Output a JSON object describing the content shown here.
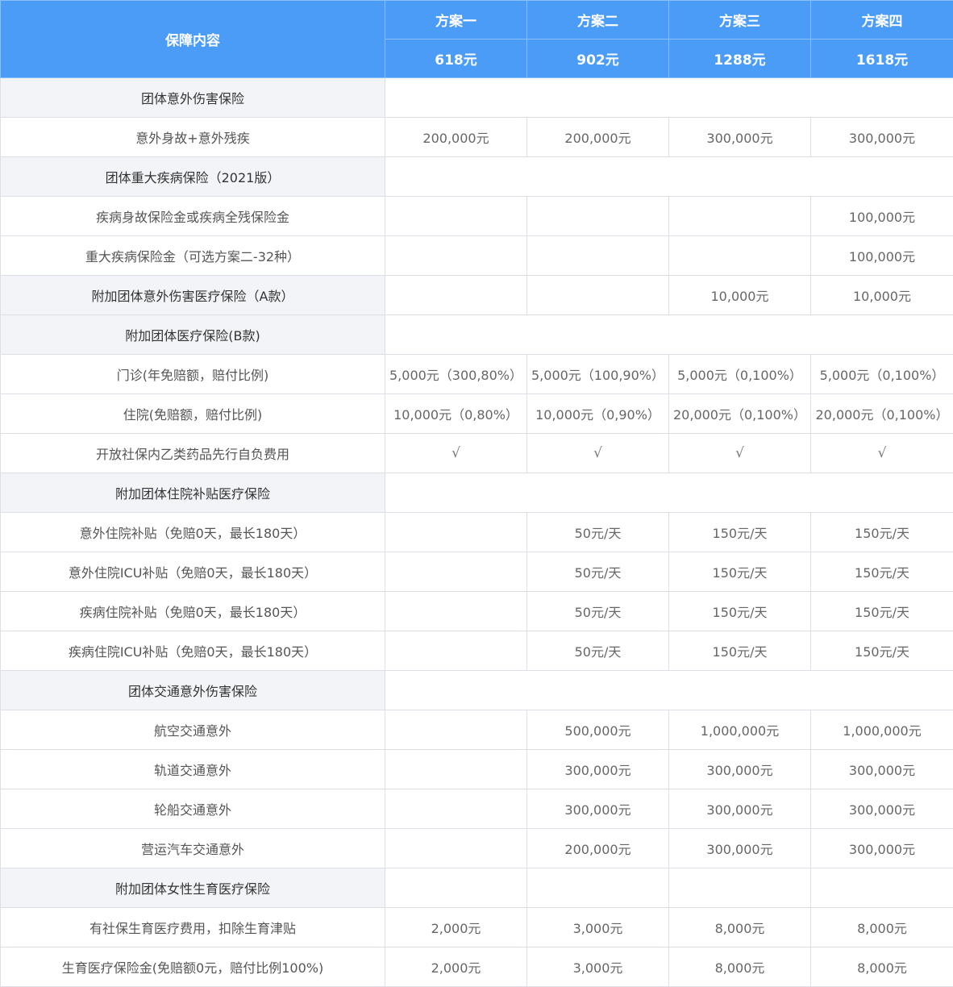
{
  "header": {
    "corner": "保障内容",
    "plans": [
      "方案一",
      "方案二",
      "方案三",
      "方案四"
    ],
    "prices": [
      "618元",
      "902元",
      "1288元",
      "1618元"
    ]
  },
  "rows": [
    {
      "type": "section",
      "label": "团体意外伤害保险",
      "merged": true
    },
    {
      "type": "item",
      "label": "意外身故+意外残疾",
      "values": [
        "200,000元",
        "200,000元",
        "300,000元",
        "300,000元"
      ]
    },
    {
      "type": "section",
      "label": "团体重大疾病保险（2021版）",
      "merged": true
    },
    {
      "type": "item",
      "label": "疾病身故保险金或疾病全残保险金",
      "values": [
        "",
        "",
        "",
        "100,000元"
      ]
    },
    {
      "type": "item",
      "label": "重大疾病保险金（可选方案二-32种）",
      "values": [
        "",
        "",
        "",
        "100,000元"
      ]
    },
    {
      "type": "section",
      "label": "附加团体意外伤害医疗保险（A款）",
      "merged": false,
      "values": [
        "",
        "",
        "10,000元",
        "10,000元"
      ]
    },
    {
      "type": "section",
      "label": "附加团体医疗保险(B款)",
      "merged": true
    },
    {
      "type": "item",
      "label": "门诊(年免赔额，赔付比例)",
      "values": [
        "5,000元（300,80%）",
        "5,000元（100,90%）",
        "5,000元（0,100%）",
        "5,000元（0,100%）"
      ]
    },
    {
      "type": "item",
      "label": "住院(免赔额，赔付比例)",
      "values": [
        "10,000元（0,80%）",
        "10,000元（0,90%）",
        "20,000元（0,100%）",
        "20,000元（0,100%）"
      ]
    },
    {
      "type": "item",
      "label": "开放社保内乙类药品先行自负费用",
      "values": [
        "√",
        "√",
        "√",
        "√"
      ]
    },
    {
      "type": "section",
      "label": "附加团体住院补贴医疗保险",
      "merged": true
    },
    {
      "type": "item",
      "label": "意外住院补贴（免赔0天，最长180天）",
      "values": [
        "",
        "50元/天",
        "150元/天",
        "150元/天"
      ]
    },
    {
      "type": "item",
      "label": "意外住院ICU补贴（免赔0天，最长180天）",
      "values": [
        "",
        "50元/天",
        "150元/天",
        "150元/天"
      ]
    },
    {
      "type": "item",
      "label": "疾病住院补贴（免赔0天，最长180天）",
      "values": [
        "",
        "50元/天",
        "150元/天",
        "150元/天"
      ]
    },
    {
      "type": "item",
      "label": "疾病住院ICU补贴（免赔0天，最长180天）",
      "values": [
        "",
        "50元/天",
        "150元/天",
        "150元/天"
      ]
    },
    {
      "type": "section",
      "label": "团体交通意外伤害保险",
      "merged": true
    },
    {
      "type": "item",
      "label": "航空交通意外",
      "values": [
        "",
        "500,000元",
        "1,000,000元",
        "1,000,000元"
      ]
    },
    {
      "type": "item",
      "label": "轨道交通意外",
      "values": [
        "",
        "300,000元",
        "300,000元",
        "300,000元"
      ]
    },
    {
      "type": "item",
      "label": "轮船交通意外",
      "values": [
        "",
        "300,000元",
        "300,000元",
        "300,000元"
      ]
    },
    {
      "type": "item",
      "label": "营运汽车交通意外",
      "values": [
        "",
        "200,000元",
        "300,000元",
        "300,000元"
      ]
    },
    {
      "type": "section",
      "label": "附加团体女性生育医疗保险",
      "merged": false,
      "values": [
        "",
        "",
        "",
        ""
      ]
    },
    {
      "type": "item",
      "label": "有社保生育医疗费用，扣除生育津贴",
      "values": [
        "2,000元",
        "3,000元",
        "8,000元",
        "8,000元"
      ]
    },
    {
      "type": "item",
      "label": "生育医疗保险金(免赔额0元，赔付比例100%)",
      "values": [
        "2,000元",
        "3,000元",
        "8,000元",
        "8,000元"
      ]
    }
  ]
}
